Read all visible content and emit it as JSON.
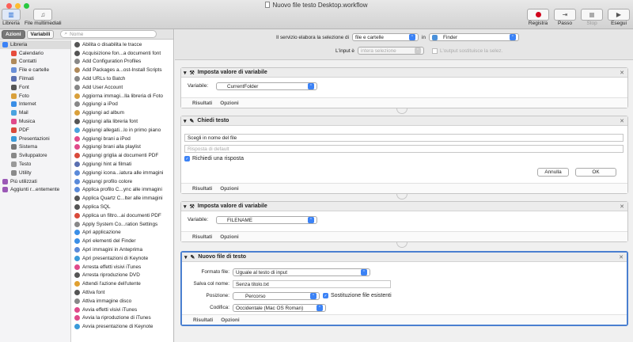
{
  "window": {
    "title": "Nuovo file testo Desktop.workflow"
  },
  "toolbar": {
    "left": [
      {
        "label": "Libreria",
        "icon": "library-icon"
      },
      {
        "label": "File multimediali",
        "icon": "media-icon"
      }
    ],
    "right": [
      {
        "label": "Registra",
        "icon": "record-icon"
      },
      {
        "label": "Passo",
        "icon": "step-icon"
      },
      {
        "label": "Stop",
        "icon": "stop-icon"
      },
      {
        "label": "Esegui",
        "icon": "run-icon"
      }
    ]
  },
  "left": {
    "tab_actions": "Azioni",
    "tab_variables": "Variabili",
    "search_placeholder": "Nome",
    "library": [
      {
        "label": "Libreria",
        "color": "#3b82f6"
      },
      {
        "label": "Calendario",
        "color": "#e74c3c"
      },
      {
        "label": "Contatti",
        "color": "#b08a5a"
      },
      {
        "label": "File e cartelle",
        "color": "#6a8fd8"
      },
      {
        "label": "Filmati",
        "color": "#5a6fb0"
      },
      {
        "label": "Font",
        "color": "#555555"
      },
      {
        "label": "Foto",
        "color": "#d9a03b"
      },
      {
        "label": "Internet",
        "color": "#3a8ee6"
      },
      {
        "label": "Mail",
        "color": "#4aa3df"
      },
      {
        "label": "Musica",
        "color": "#e04a8a"
      },
      {
        "label": "PDF",
        "color": "#d94a3a"
      },
      {
        "label": "Presentazioni",
        "color": "#3a9ad9"
      },
      {
        "label": "Sistema",
        "color": "#777777"
      },
      {
        "label": "Sviluppatore",
        "color": "#888888"
      },
      {
        "label": "Testo",
        "color": "#999999"
      },
      {
        "label": "Utility",
        "color": "#8a8a8a"
      },
      {
        "label": "Più utilizzati",
        "color": "#9b59b6"
      },
      {
        "label": "Aggiunti r...entemente",
        "color": "#9b59b6"
      }
    ],
    "actions": [
      {
        "label": "Abilita o disabilita le tracce",
        "color": "#555555"
      },
      {
        "label": "Acquisizione fon...a documenti font",
        "color": "#555555"
      },
      {
        "label": "Add Configuration Profiles",
        "color": "#888888"
      },
      {
        "label": "Add Packages a...ost-Install Scripts",
        "color": "#b08a5a"
      },
      {
        "label": "Add URLs to Batch",
        "color": "#888888"
      },
      {
        "label": "Add User Account",
        "color": "#888888"
      },
      {
        "label": "Aggiorna immagi...lla libreria di Foto",
        "color": "#d9a03b"
      },
      {
        "label": "Aggiungi a iPod",
        "color": "#888888"
      },
      {
        "label": "Aggiungi ad album",
        "color": "#d9a03b"
      },
      {
        "label": "Aggiungi alla libreria font",
        "color": "#555555"
      },
      {
        "label": "Aggiungi allegati...lo in primo piano",
        "color": "#4aa3df"
      },
      {
        "label": "Aggiungi brani a iPod",
        "color": "#e04a8a"
      },
      {
        "label": "Aggiungi brani alla playlist",
        "color": "#e04a8a"
      },
      {
        "label": "Aggiungi griglia ai documenti PDF",
        "color": "#d94a3a"
      },
      {
        "label": "Aggiungi hint ai filmati",
        "color": "#5a6fb0"
      },
      {
        "label": "Aggiungi icona...iatura alle immagini",
        "color": "#5a8ad9"
      },
      {
        "label": "Aggiungi profilo colore",
        "color": "#5a8ad9"
      },
      {
        "label": "Applica profilo C...ync alle immagini",
        "color": "#5a8ad9"
      },
      {
        "label": "Applica Quartz C...lter alle immagini",
        "color": "#555555"
      },
      {
        "label": "Applica SQL",
        "color": "#555555"
      },
      {
        "label": "Applica un filtro...ai documenti PDF",
        "color": "#d94a3a"
      },
      {
        "label": "Apply System Co...ration Settings",
        "color": "#888888"
      },
      {
        "label": "Apri applicazione",
        "color": "#3a8ee6"
      },
      {
        "label": "Apri elementi del Finder",
        "color": "#3a8ee6"
      },
      {
        "label": "Apri immagini in Anteprima",
        "color": "#5a8ad9"
      },
      {
        "label": "Apri presentazioni di Keynote",
        "color": "#3a9ad9"
      },
      {
        "label": "Arresta effetti visivi iTunes",
        "color": "#e04a8a"
      },
      {
        "label": "Arresta riproduzione DVD",
        "color": "#555555"
      },
      {
        "label": "Attendi l'azione dell'utente",
        "color": "#e0a030"
      },
      {
        "label": "Attiva font",
        "color": "#555555"
      },
      {
        "label": "Attiva immagine disco",
        "color": "#888888"
      },
      {
        "label": "Avvia effetti visivi iTunes",
        "color": "#e04a8a"
      },
      {
        "label": "Avvia la riproduzione di iTunes",
        "color": "#e04a8a"
      },
      {
        "label": "Avvia presentazione di Keynote",
        "color": "#3a9ad9"
      }
    ]
  },
  "service": {
    "prefix": "Il servizio elabora la selezione di",
    "type_value": "file e cartelle",
    "in_label": "in",
    "app_value": "Finder",
    "input_label": "L'input è",
    "input_value": "intera selezione",
    "replace_label": "L'output sostituisce la selez."
  },
  "cards": {
    "set_var1": {
      "title": "Imposta valore di variabile",
      "var_label": "Variabile:",
      "var_value": "CurrentFolder",
      "results": "Risultati",
      "options": "Opzioni"
    },
    "ask_text": {
      "title": "Chiedi testo",
      "question": "Scegli in nome del file",
      "default_placeholder": "Risposta di default",
      "require_label": "Richiedi una risposta",
      "cancel": "Annulla",
      "ok": "OK",
      "results": "Risultati",
      "options": "Opzioni"
    },
    "set_var2": {
      "title": "Imposta valore di variabile",
      "var_label": "Variabile:",
      "var_value": "FILENAME",
      "results": "Risultati",
      "options": "Opzioni"
    },
    "new_file": {
      "title": "Nuovo file di testo",
      "format_label": "Formato file:",
      "format_value": "Uguale al testo di input",
      "save_label": "Salva col nome:",
      "save_value": "Senza titolo.txt",
      "position_label": "Posizione:",
      "position_value": "Percorso",
      "replace_label": "Sostituzione file esistenti",
      "encoding_label": "Codifica:",
      "encoding_value": "Occidentale (Mac OS Roman)",
      "results": "Risultati",
      "options": "Opzioni"
    }
  }
}
